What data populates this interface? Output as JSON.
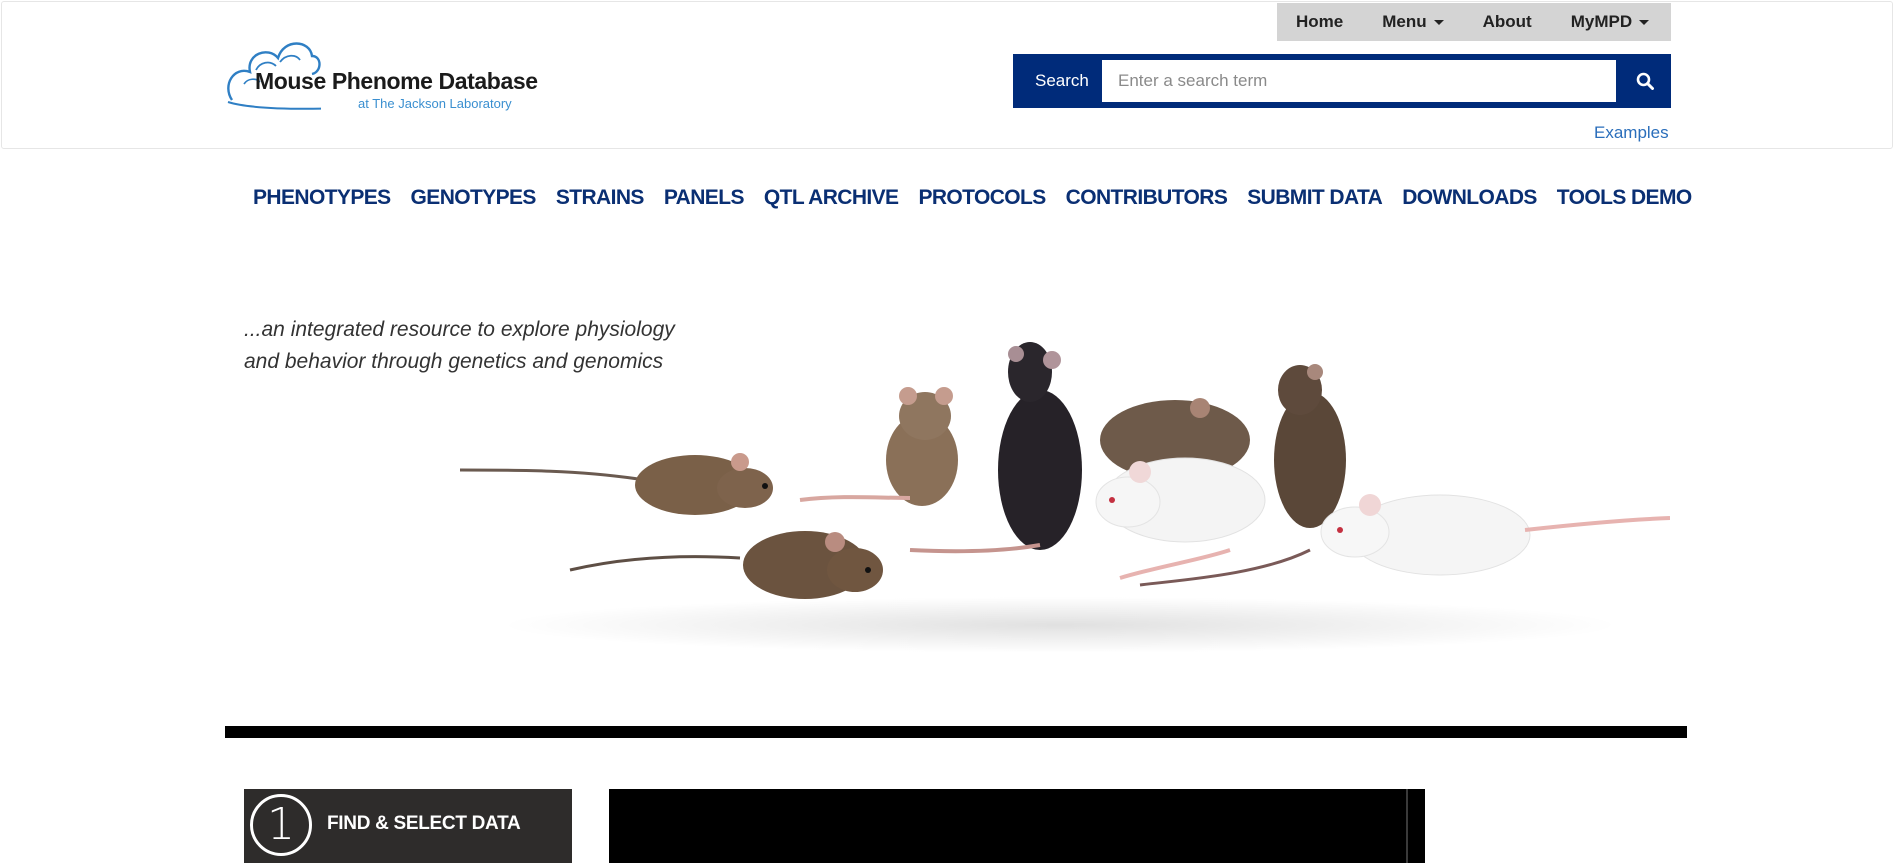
{
  "logo": {
    "title": "Mouse Phenome Database",
    "subtitle": "at The Jackson Laboratory"
  },
  "topnav": {
    "items": [
      {
        "label": "Home",
        "dropdown": false
      },
      {
        "label": "Menu",
        "dropdown": true
      },
      {
        "label": "About",
        "dropdown": false
      },
      {
        "label": "MyMPD",
        "dropdown": true
      }
    ]
  },
  "search": {
    "label": "Search",
    "placeholder": "Enter a search term",
    "value": "",
    "button_icon": "magnifier-icon",
    "examples_link": "Examples"
  },
  "mainnav": {
    "items": [
      "PHENOTYPES",
      "GENOTYPES",
      "STRAINS",
      "PANELS",
      "QTL ARCHIVE",
      "PROTOCOLS",
      "CONTRIBUTORS",
      "SUBMIT DATA",
      "DOWNLOADS",
      "TOOLS DEMO"
    ]
  },
  "hero": {
    "tagline_line1": "...an integrated resource to explore physiology",
    "tagline_line2": "and behavior through genetics and genomics"
  },
  "steps": [
    {
      "number": "1",
      "label": "FIND & SELECT DATA"
    }
  ],
  "colors": {
    "brand_navy": "#002b7a",
    "nav_text": "#0a2f73",
    "link_blue": "#2a6ebb",
    "topnav_bg": "#d4d4d4"
  }
}
